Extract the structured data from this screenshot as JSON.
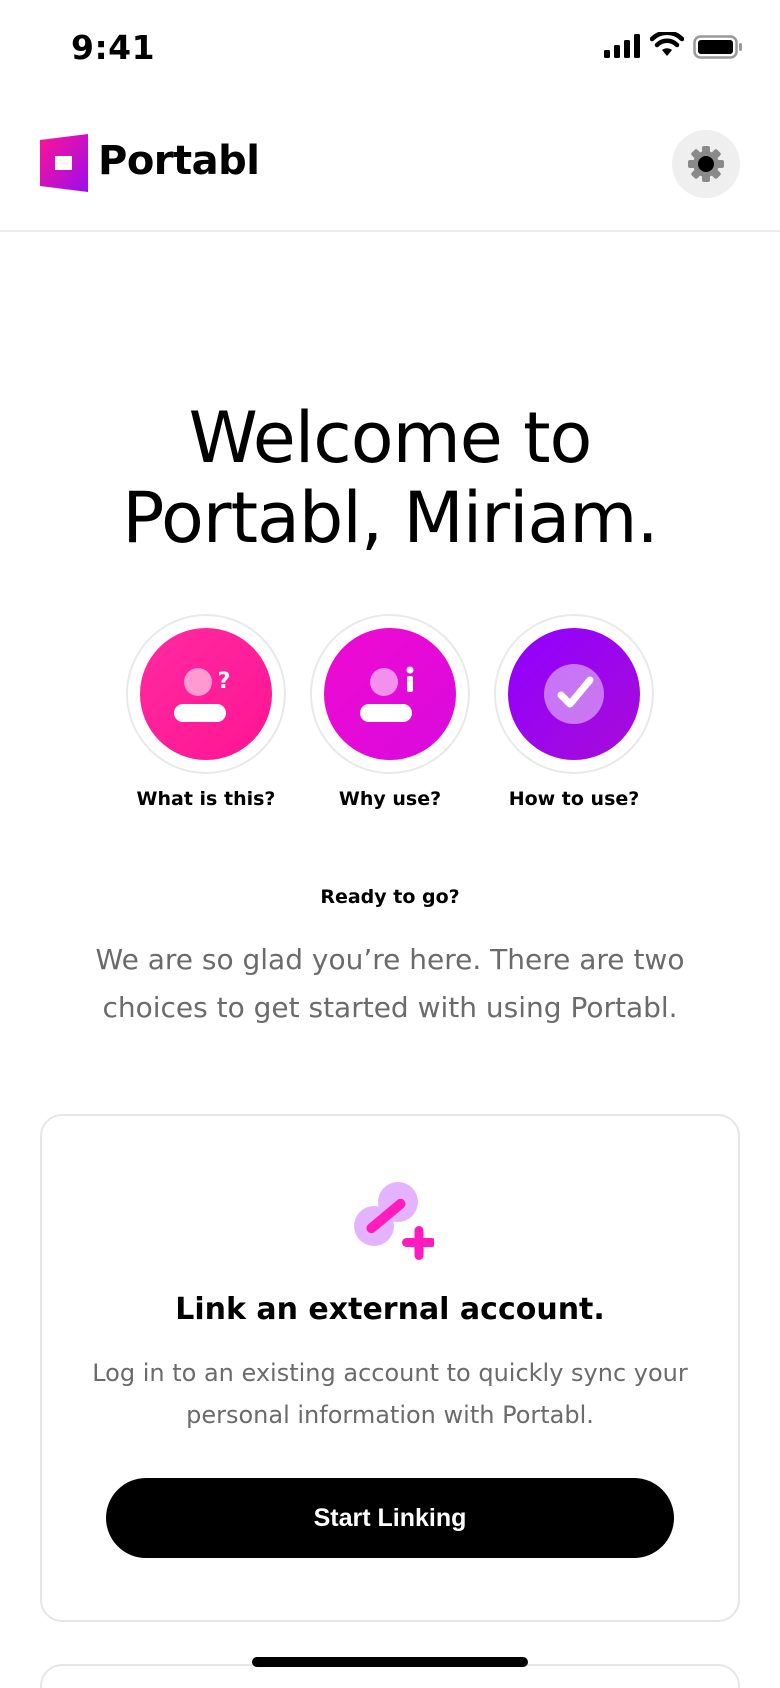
{
  "status_bar": {
    "time": "9:41"
  },
  "header": {
    "brand": "Portabl",
    "settings_icon": "gear-icon"
  },
  "welcome": {
    "line1": "Welcome to",
    "line2": "Portabl, Miriam."
  },
  "info_buttons": [
    {
      "label": "What is this?",
      "icon": "user-question-icon",
      "color": "#ff1493"
    },
    {
      "label": "Why use?",
      "icon": "user-info-icon",
      "color": "#e60ad9"
    },
    {
      "label": "How to use?",
      "icon": "check-circle-icon",
      "color": "#9b0cf0"
    }
  ],
  "ready": {
    "heading": "Ready to go?",
    "text": "We are so glad you’re here. There are two choices to get started with using Portabl."
  },
  "link_card": {
    "icon": "link-add-icon",
    "title": "Link an external account.",
    "description": "Log in to an existing account to quickly sync your personal information with Portabl.",
    "button": "Start Linking"
  },
  "colors": {
    "accent_pink": "#ff1493",
    "accent_magenta": "#e60ad9",
    "accent_purple": "#9b0cf0",
    "button_black": "#000000"
  }
}
